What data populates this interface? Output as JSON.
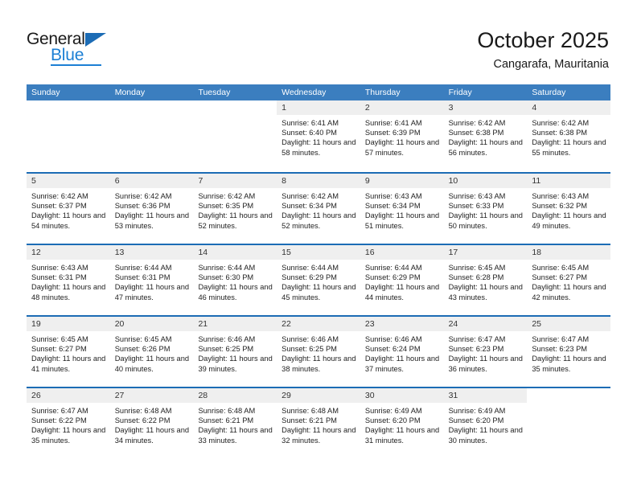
{
  "brand": {
    "name_top": "General",
    "name_bottom": "Blue",
    "accent_color": "#1c7fd4",
    "triangle_color": "#1c6cb5"
  },
  "header": {
    "title": "October 2025",
    "subtitle": "Cangarafa, Mauritania"
  },
  "theme": {
    "header_row_bg": "#3b7ebf",
    "week_divider": "#1c6cb5",
    "daynum_band_bg": "#efefef"
  },
  "weekdays": [
    "Sunday",
    "Monday",
    "Tuesday",
    "Wednesday",
    "Thursday",
    "Friday",
    "Saturday"
  ],
  "weeks": [
    [
      {
        "empty": true
      },
      {
        "empty": true
      },
      {
        "empty": true
      },
      {
        "day": "1",
        "sunrise": "Sunrise: 6:41 AM",
        "sunset": "Sunset: 6:40 PM",
        "daylight": "Daylight: 11 hours and 58 minutes."
      },
      {
        "day": "2",
        "sunrise": "Sunrise: 6:41 AM",
        "sunset": "Sunset: 6:39 PM",
        "daylight": "Daylight: 11 hours and 57 minutes."
      },
      {
        "day": "3",
        "sunrise": "Sunrise: 6:42 AM",
        "sunset": "Sunset: 6:38 PM",
        "daylight": "Daylight: 11 hours and 56 minutes."
      },
      {
        "day": "4",
        "sunrise": "Sunrise: 6:42 AM",
        "sunset": "Sunset: 6:38 PM",
        "daylight": "Daylight: 11 hours and 55 minutes."
      }
    ],
    [
      {
        "day": "5",
        "sunrise": "Sunrise: 6:42 AM",
        "sunset": "Sunset: 6:37 PM",
        "daylight": "Daylight: 11 hours and 54 minutes."
      },
      {
        "day": "6",
        "sunrise": "Sunrise: 6:42 AM",
        "sunset": "Sunset: 6:36 PM",
        "daylight": "Daylight: 11 hours and 53 minutes."
      },
      {
        "day": "7",
        "sunrise": "Sunrise: 6:42 AM",
        "sunset": "Sunset: 6:35 PM",
        "daylight": "Daylight: 11 hours and 52 minutes."
      },
      {
        "day": "8",
        "sunrise": "Sunrise: 6:42 AM",
        "sunset": "Sunset: 6:34 PM",
        "daylight": "Daylight: 11 hours and 52 minutes."
      },
      {
        "day": "9",
        "sunrise": "Sunrise: 6:43 AM",
        "sunset": "Sunset: 6:34 PM",
        "daylight": "Daylight: 11 hours and 51 minutes."
      },
      {
        "day": "10",
        "sunrise": "Sunrise: 6:43 AM",
        "sunset": "Sunset: 6:33 PM",
        "daylight": "Daylight: 11 hours and 50 minutes."
      },
      {
        "day": "11",
        "sunrise": "Sunrise: 6:43 AM",
        "sunset": "Sunset: 6:32 PM",
        "daylight": "Daylight: 11 hours and 49 minutes."
      }
    ],
    [
      {
        "day": "12",
        "sunrise": "Sunrise: 6:43 AM",
        "sunset": "Sunset: 6:31 PM",
        "daylight": "Daylight: 11 hours and 48 minutes."
      },
      {
        "day": "13",
        "sunrise": "Sunrise: 6:44 AM",
        "sunset": "Sunset: 6:31 PM",
        "daylight": "Daylight: 11 hours and 47 minutes."
      },
      {
        "day": "14",
        "sunrise": "Sunrise: 6:44 AM",
        "sunset": "Sunset: 6:30 PM",
        "daylight": "Daylight: 11 hours and 46 minutes."
      },
      {
        "day": "15",
        "sunrise": "Sunrise: 6:44 AM",
        "sunset": "Sunset: 6:29 PM",
        "daylight": "Daylight: 11 hours and 45 minutes."
      },
      {
        "day": "16",
        "sunrise": "Sunrise: 6:44 AM",
        "sunset": "Sunset: 6:29 PM",
        "daylight": "Daylight: 11 hours and 44 minutes."
      },
      {
        "day": "17",
        "sunrise": "Sunrise: 6:45 AM",
        "sunset": "Sunset: 6:28 PM",
        "daylight": "Daylight: 11 hours and 43 minutes."
      },
      {
        "day": "18",
        "sunrise": "Sunrise: 6:45 AM",
        "sunset": "Sunset: 6:27 PM",
        "daylight": "Daylight: 11 hours and 42 minutes."
      }
    ],
    [
      {
        "day": "19",
        "sunrise": "Sunrise: 6:45 AM",
        "sunset": "Sunset: 6:27 PM",
        "daylight": "Daylight: 11 hours and 41 minutes."
      },
      {
        "day": "20",
        "sunrise": "Sunrise: 6:45 AM",
        "sunset": "Sunset: 6:26 PM",
        "daylight": "Daylight: 11 hours and 40 minutes."
      },
      {
        "day": "21",
        "sunrise": "Sunrise: 6:46 AM",
        "sunset": "Sunset: 6:25 PM",
        "daylight": "Daylight: 11 hours and 39 minutes."
      },
      {
        "day": "22",
        "sunrise": "Sunrise: 6:46 AM",
        "sunset": "Sunset: 6:25 PM",
        "daylight": "Daylight: 11 hours and 38 minutes."
      },
      {
        "day": "23",
        "sunrise": "Sunrise: 6:46 AM",
        "sunset": "Sunset: 6:24 PM",
        "daylight": "Daylight: 11 hours and 37 minutes."
      },
      {
        "day": "24",
        "sunrise": "Sunrise: 6:47 AM",
        "sunset": "Sunset: 6:23 PM",
        "daylight": "Daylight: 11 hours and 36 minutes."
      },
      {
        "day": "25",
        "sunrise": "Sunrise: 6:47 AM",
        "sunset": "Sunset: 6:23 PM",
        "daylight": "Daylight: 11 hours and 35 minutes."
      }
    ],
    [
      {
        "day": "26",
        "sunrise": "Sunrise: 6:47 AM",
        "sunset": "Sunset: 6:22 PM",
        "daylight": "Daylight: 11 hours and 35 minutes."
      },
      {
        "day": "27",
        "sunrise": "Sunrise: 6:48 AM",
        "sunset": "Sunset: 6:22 PM",
        "daylight": "Daylight: 11 hours and 34 minutes."
      },
      {
        "day": "28",
        "sunrise": "Sunrise: 6:48 AM",
        "sunset": "Sunset: 6:21 PM",
        "daylight": "Daylight: 11 hours and 33 minutes."
      },
      {
        "day": "29",
        "sunrise": "Sunrise: 6:48 AM",
        "sunset": "Sunset: 6:21 PM",
        "daylight": "Daylight: 11 hours and 32 minutes."
      },
      {
        "day": "30",
        "sunrise": "Sunrise: 6:49 AM",
        "sunset": "Sunset: 6:20 PM",
        "daylight": "Daylight: 11 hours and 31 minutes."
      },
      {
        "day": "31",
        "sunrise": "Sunrise: 6:49 AM",
        "sunset": "Sunset: 6:20 PM",
        "daylight": "Daylight: 11 hours and 30 minutes."
      },
      {
        "empty": true
      }
    ]
  ]
}
